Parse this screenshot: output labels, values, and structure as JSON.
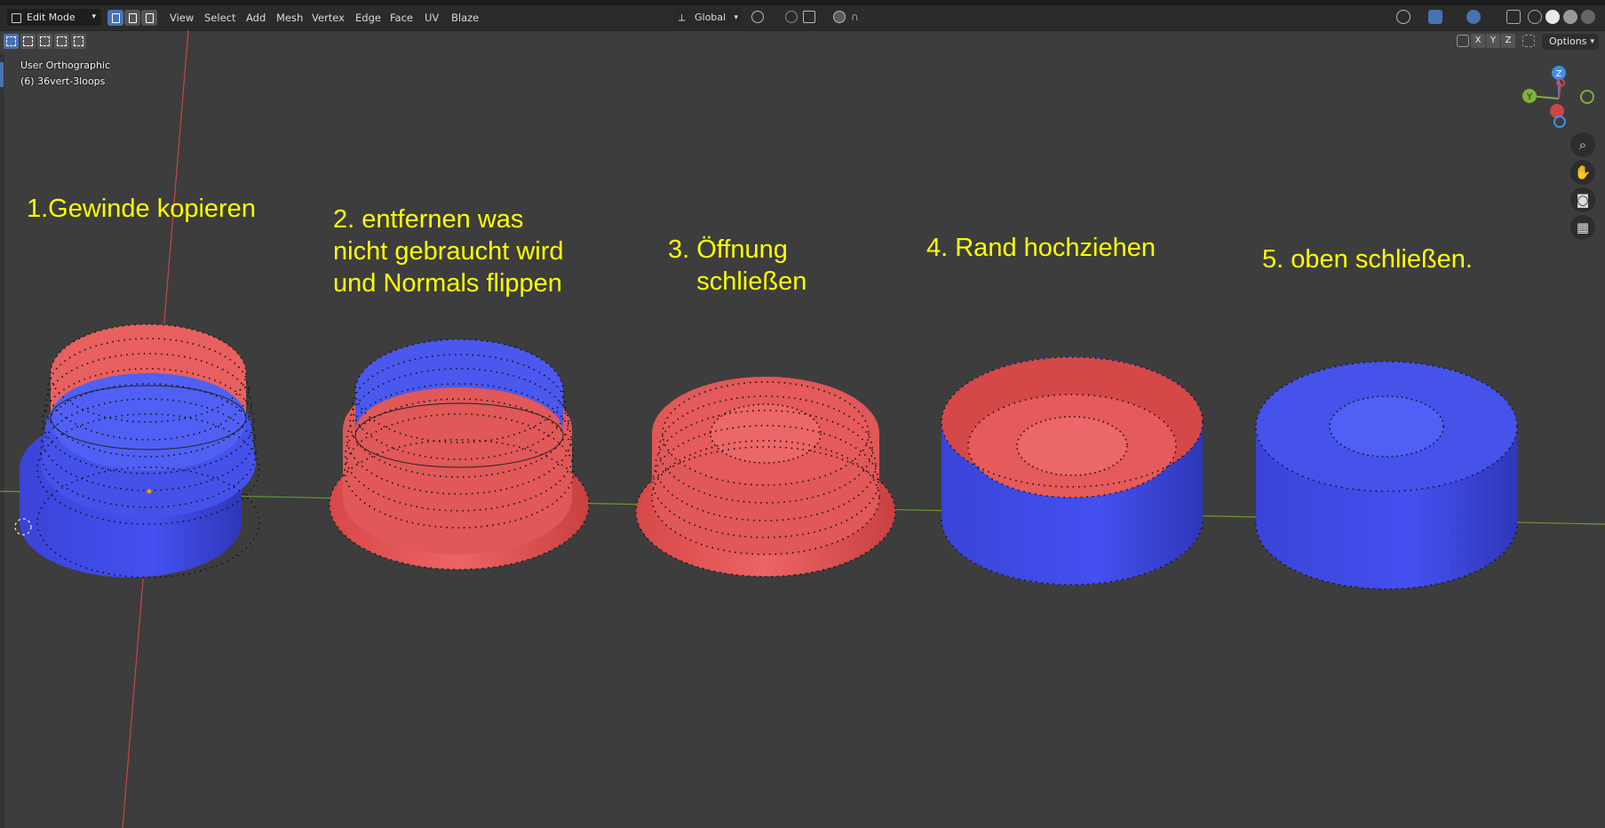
{
  "header": {
    "mode": "Edit Mode",
    "menus": [
      "View",
      "Select",
      "Add",
      "Mesh",
      "Vertex",
      "Edge",
      "Face",
      "UV",
      "Blaze"
    ],
    "transform_orientation": "Global",
    "options_label": "Options",
    "axis_buttons": [
      "X",
      "Y",
      "Z"
    ]
  },
  "viewport": {
    "view_name": "User Orthographic",
    "object_info": "(6) 36vert-3loops"
  },
  "annotations": [
    {
      "text": "1.Gewinde kopieren"
    },
    {
      "text": "2. entfernen was\nnicht gebraucht wird\nund Normals flippen"
    },
    {
      "text": "3. Öffnung\n    schließen"
    },
    {
      "text": "4. Rand hochziehen"
    },
    {
      "text": "5. oben schließen."
    }
  ],
  "gizmo_axes": [
    "Z",
    "Y"
  ],
  "colors": {
    "face_front": "#3f4be0",
    "face_back": "#e05252",
    "annotation": "#ffff00",
    "active_blue": "#4772b3"
  }
}
